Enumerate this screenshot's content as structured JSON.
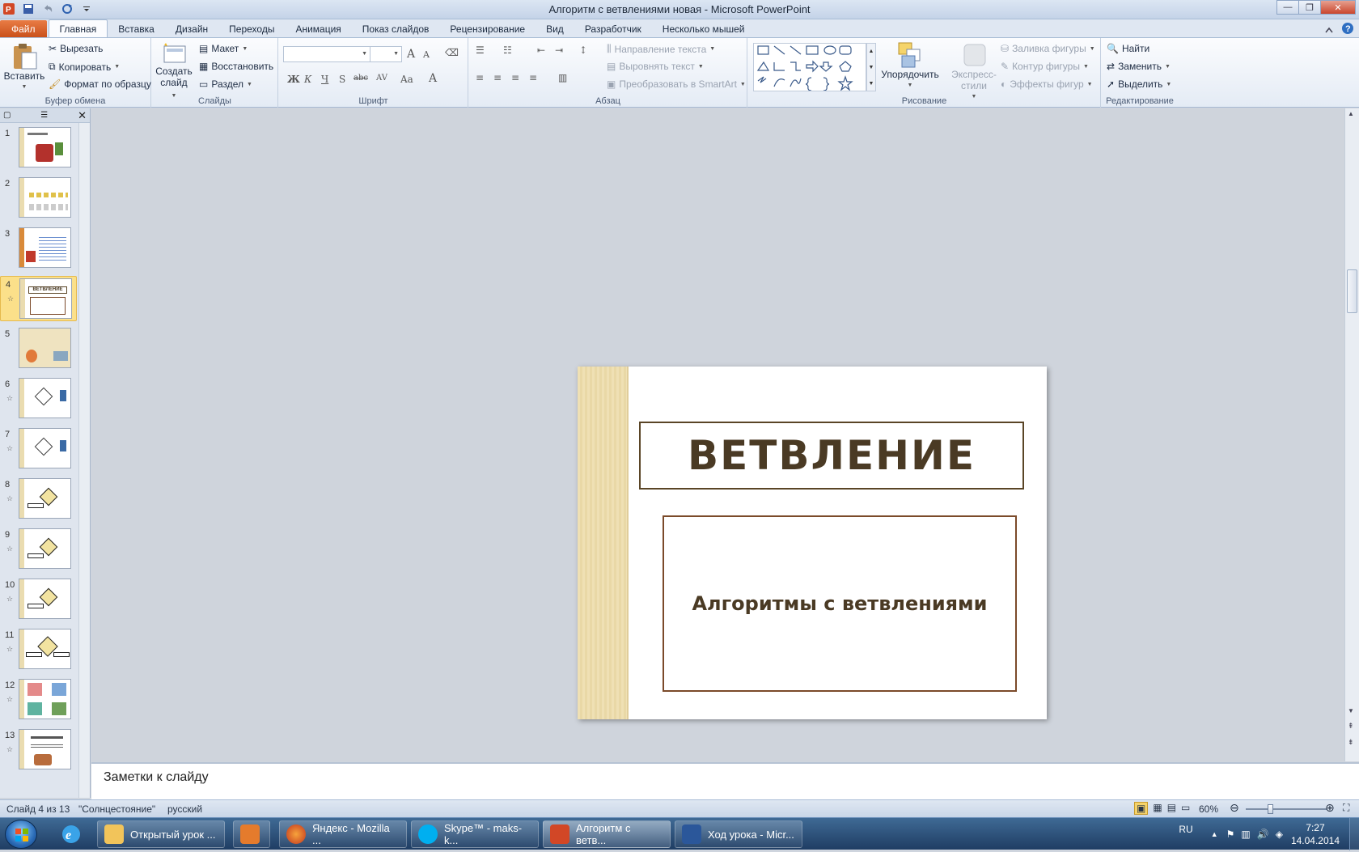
{
  "window": {
    "title": "Алгоритм с ветвлениями новая - Microsoft PowerPoint",
    "controls": [
      "—",
      "❐",
      "✕"
    ]
  },
  "tabs": [
    {
      "label": "Файл"
    },
    {
      "label": "Главная"
    },
    {
      "label": "Вставка"
    },
    {
      "label": "Дизайн"
    },
    {
      "label": "Переходы"
    },
    {
      "label": "Анимация"
    },
    {
      "label": "Показ слайдов"
    },
    {
      "label": "Рецензирование"
    },
    {
      "label": "Вид"
    },
    {
      "label": "Разработчик"
    },
    {
      "label": "Несколько мышей"
    }
  ],
  "ribbon": {
    "clipboard": {
      "label": "Буфер обмена",
      "paste": "Вставить",
      "cut": "Вырезать",
      "copy": "Копировать",
      "format_painter": "Формат по образцу"
    },
    "slides": {
      "label": "Слайды",
      "new_slide_1": "Создать",
      "new_slide_2": "слайд",
      "layout": "Макет",
      "reset": "Восстановить",
      "section": "Раздел"
    },
    "font": {
      "label": "Шрифт",
      "font_name": "",
      "font_size": "",
      "bold": "Ж",
      "italic": "К",
      "underline": "Ч",
      "shadow": "S",
      "strike": "abc",
      "spacing": "AV",
      "case": "Aa",
      "color": "A",
      "grow": "A",
      "shrink": "A"
    },
    "paragraph": {
      "label": "Абзац",
      "text_direction": "Направление текста",
      "align_text": "Выровнять текст",
      "smartart": "Преобразовать в SmartArt"
    },
    "drawing": {
      "label": "Рисование",
      "arrange": "Упорядочить",
      "quick_styles": "Экспресс-стили",
      "shape_fill": "Заливка фигуры",
      "shape_outline": "Контур фигуры",
      "shape_effects": "Эффекты фигур"
    },
    "editing": {
      "label": "Редактирование",
      "find": "Найти",
      "replace": "Заменить",
      "select": "Выделить"
    }
  },
  "thumbnails": [
    {
      "num": "1",
      "star": ""
    },
    {
      "num": "2",
      "star": ""
    },
    {
      "num": "3",
      "star": ""
    },
    {
      "num": "4",
      "star": "☆"
    },
    {
      "num": "5",
      "star": ""
    },
    {
      "num": "6",
      "star": "☆"
    },
    {
      "num": "7",
      "star": "☆"
    },
    {
      "num": "8",
      "star": "☆"
    },
    {
      "num": "9",
      "star": "☆"
    },
    {
      "num": "10",
      "star": "☆"
    },
    {
      "num": "11",
      "star": "☆"
    },
    {
      "num": "12",
      "star": "☆"
    },
    {
      "num": "13",
      "star": "☆"
    }
  ],
  "slide": {
    "title": "ВЕТВЛЕНИЕ",
    "subtitle": "Алгоритмы с ветвлениями"
  },
  "notes": {
    "placeholder": "Заметки к слайду"
  },
  "status": {
    "slide_info": "Слайд 4 из 13",
    "theme": "\"Солнцестояние\"",
    "language": "русский",
    "zoom": "60%",
    "zoom_level": 0.6
  },
  "taskbar": {
    "items": [
      {
        "label": "Открытый урок ..."
      },
      {
        "label": ""
      },
      {
        "label": "Яндекс - Mozilla ..."
      },
      {
        "label": "Skype™ - maks-k..."
      },
      {
        "label": "Алгоритм с ветв..."
      },
      {
        "label": "Ход урока - Micr..."
      }
    ],
    "lang": "RU",
    "time": "7:27",
    "date": "14.04.2014"
  },
  "colors": {
    "file_tab": "#d8611f",
    "slide_text": "#4a3a24",
    "selected_thumb": "#fbe08a"
  }
}
